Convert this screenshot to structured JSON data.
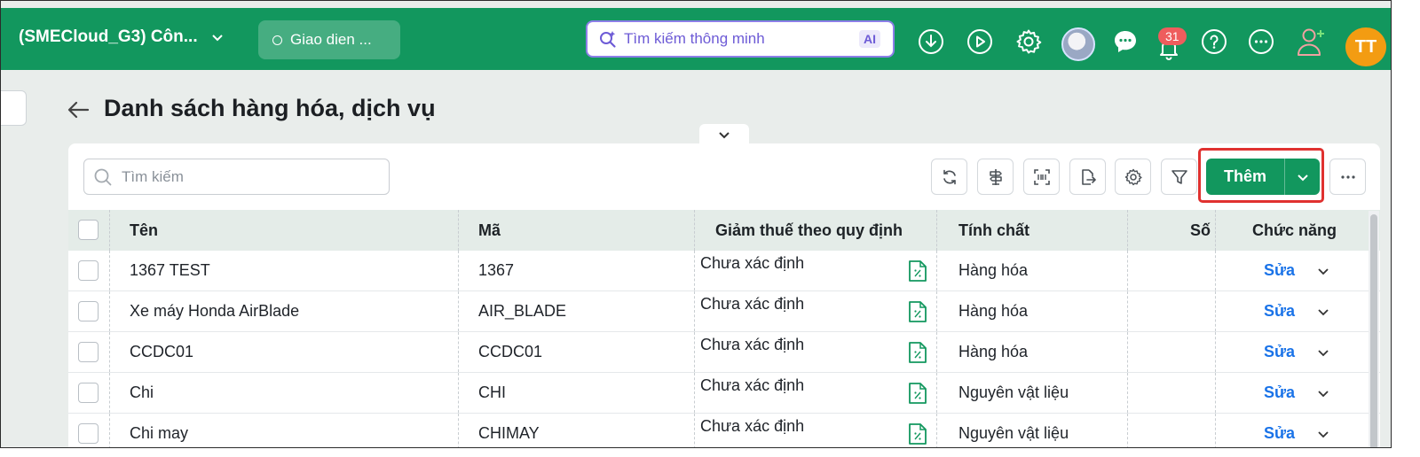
{
  "topbar": {
    "company_name": "(SMECloud_G3) Côn...",
    "mode_label": "Giao dien ...",
    "smart_search_placeholder": "Tìm kiếm thông minh",
    "ai_badge": "AI",
    "notification_count": "31",
    "user_initials": "TT",
    "icons": [
      "download-icon",
      "play-icon",
      "gear-icon",
      "chat-icon",
      "bell-icon",
      "help-icon",
      "more-icon",
      "add-user-icon"
    ]
  },
  "page": {
    "title": "Danh sách hàng hóa, dịch vụ"
  },
  "toolbar": {
    "search_placeholder": "Tìm kiếm",
    "add_label": "Thêm",
    "tools": [
      "refresh-icon",
      "signpost-icon",
      "barcode-scan-icon",
      "export-icon",
      "settings-icon",
      "filter-icon",
      "more-icon"
    ]
  },
  "table": {
    "columns": [
      "Tên",
      "Mã",
      "Giảm thuế theo quy định",
      "Tính chất",
      "Số",
      "Chức năng"
    ],
    "rows": [
      {
        "name": "1367 TEST",
        "code": "1367",
        "tax": "Chưa xác định",
        "type": "Hàng hóa",
        "action": "Sửa"
      },
      {
        "name": "Xe máy Honda AirBlade",
        "code": "AIR_BLADE",
        "tax": "Chưa xác định",
        "type": "Hàng hóa",
        "action": "Sửa"
      },
      {
        "name": "CCDC01",
        "code": "CCDC01",
        "tax": "Chưa xác định",
        "type": "Hàng hóa",
        "action": "Sửa"
      },
      {
        "name": "Chi",
        "code": "CHI",
        "tax": "Chưa xác định",
        "type": "Nguyên vật liệu",
        "action": "Sửa"
      },
      {
        "name": "Chi may",
        "code": "CHIMAY",
        "tax": "Chưa xác định",
        "type": "Nguyên vật liệu",
        "action": "Sửa"
      }
    ]
  },
  "colors": {
    "brand_green": "#12975e",
    "link_blue": "#1a73e8",
    "highlight_red": "#e0312f",
    "avatar_orange": "#f39c12"
  }
}
